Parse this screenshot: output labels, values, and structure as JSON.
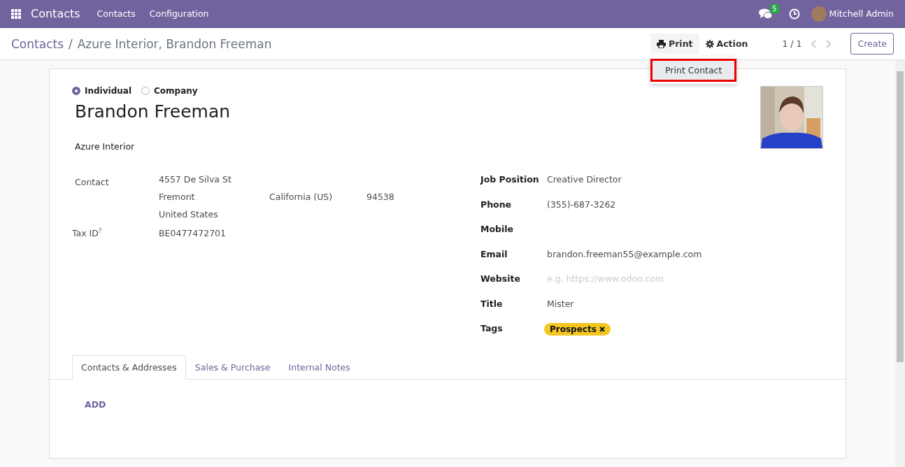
{
  "navbar": {
    "app_name": "Contacts",
    "menu": [
      "Contacts",
      "Configuration"
    ],
    "messages_count": "5",
    "user": "Mitchell Admin"
  },
  "breadcrumb": {
    "parent": "Contacts",
    "separator": "/",
    "current": "Azure Interior, Brandon Freeman"
  },
  "toolbar": {
    "print": "Print",
    "action": "Action",
    "pager": "1 / 1",
    "create": "Create"
  },
  "print_menu": {
    "items": [
      {
        "label": "Print Contact",
        "highlighted": true
      }
    ]
  },
  "form": {
    "company_type": [
      {
        "label": "Individual",
        "selected": true
      },
      {
        "label": "Company",
        "selected": false
      }
    ],
    "name": "Brandon Freeman",
    "company": "Azure Interior",
    "address": {
      "label": "Contact",
      "street": "4557 De Silva St",
      "city": "Fremont",
      "state": "California (US)",
      "zip": "94538",
      "country": "United States"
    },
    "tax_id": {
      "label": "Tax ID",
      "help_mark": "?",
      "value": "BE0477472701"
    },
    "right_fields": [
      {
        "label": "Job Position",
        "kind": "text",
        "value": "Creative Director"
      },
      {
        "label": "Phone",
        "kind": "text",
        "value": "(355)-687-3262"
      },
      {
        "label": "Mobile",
        "kind": "empty"
      },
      {
        "label": "Email",
        "kind": "text",
        "value": "brandon.freeman55@example.com"
      },
      {
        "label": "Website",
        "kind": "placeholder",
        "placeholder": "e.g. https://www.odoo.com"
      },
      {
        "label": "Title",
        "kind": "text",
        "value": "Mister"
      },
      {
        "label": "Tags",
        "kind": "tags",
        "tags": [
          {
            "label": "Prospects",
            "color": "#f4c622"
          }
        ]
      }
    ],
    "tabs": [
      {
        "label": "Contacts & Addresses",
        "selected": true
      },
      {
        "label": "Sales & Purchase",
        "selected": false
      },
      {
        "label": "Internal Notes",
        "selected": false
      }
    ],
    "add_button": "ADD"
  }
}
